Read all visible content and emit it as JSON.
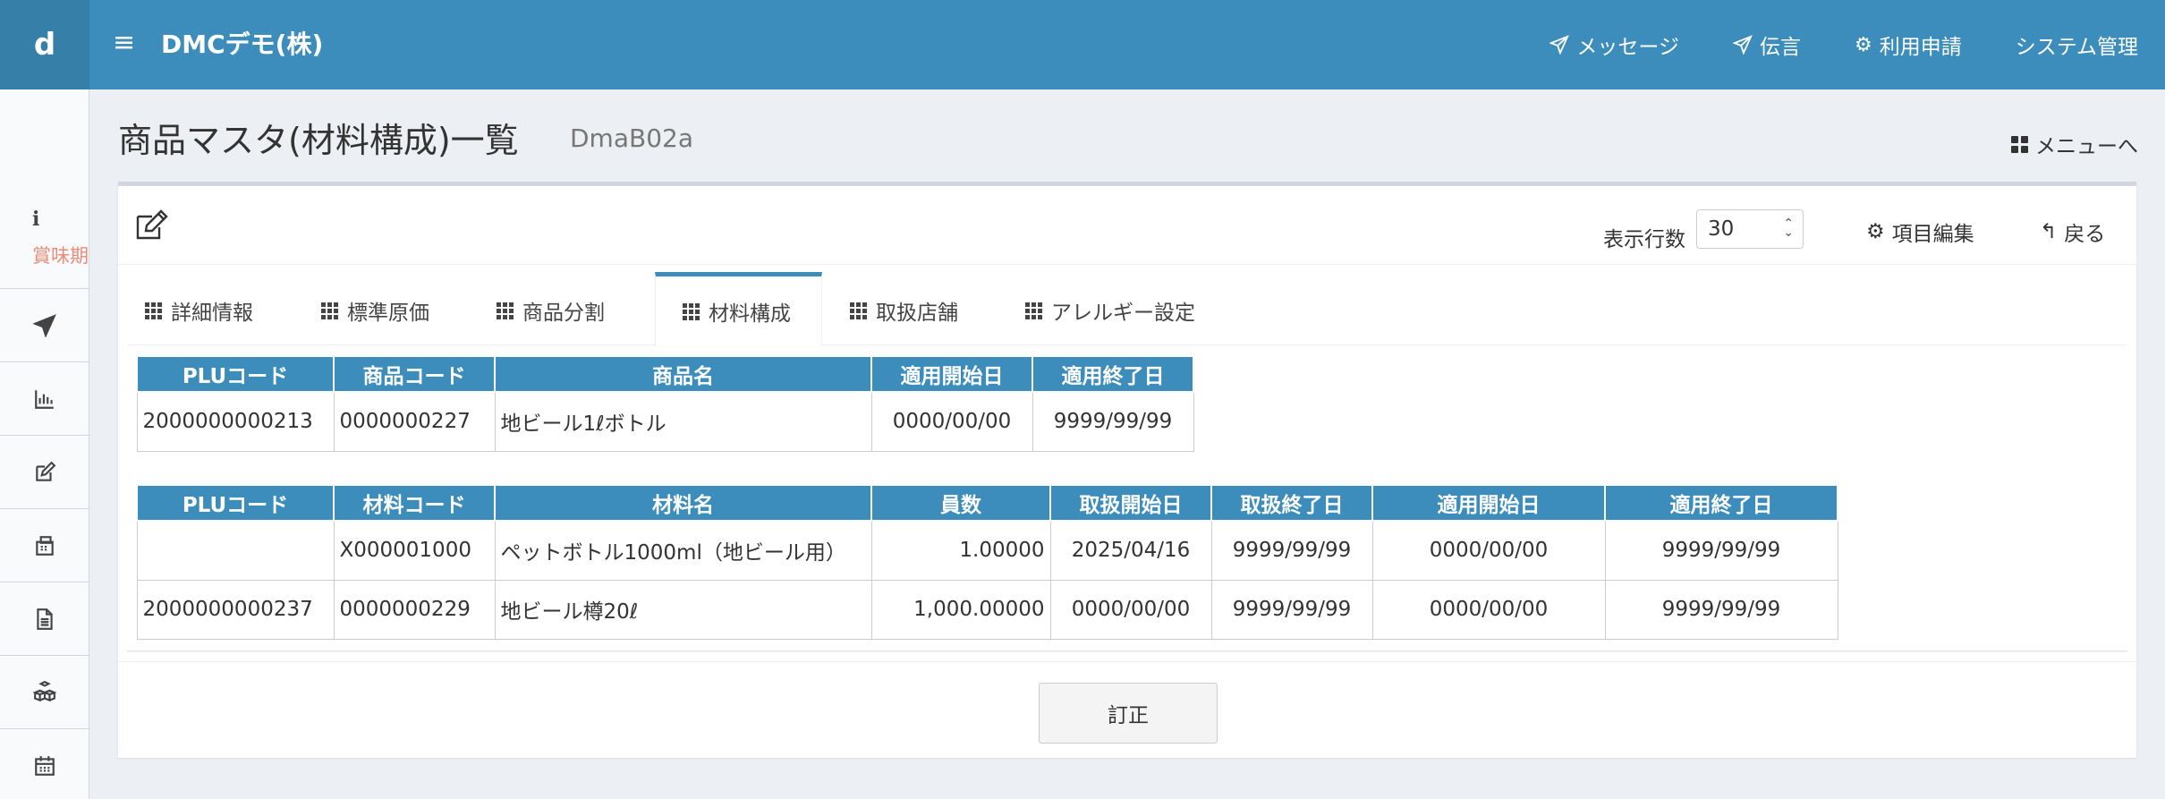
{
  "header": {
    "logo": "d",
    "hamburger": "≡",
    "brand": "DMCデモ(株)",
    "nav": [
      {
        "label": "メッセージ",
        "icon": "paper-plane-icon"
      },
      {
        "label": "伝言",
        "icon": "paper-plane-icon"
      },
      {
        "label": "利用申請",
        "icon": "gear-icon"
      },
      {
        "label": "システム管理",
        "icon": ""
      }
    ]
  },
  "sidebar": {
    "info_icon": "i",
    "info_text": "賞味期",
    "items": [
      "paper-plane-icon",
      "bar-chart-icon",
      "edit-icon",
      "fax-icon",
      "document-icon",
      "cubes-icon",
      "calendar-icon"
    ]
  },
  "page": {
    "title": "商品マスタ(材料構成)一覧",
    "code": "DmaB02a",
    "menu_link": "メニューへ"
  },
  "toolbar": {
    "rows_label": "表示行数",
    "rows_value": "30",
    "item_edit": "項目編集",
    "back": "戻る"
  },
  "tabs": [
    {
      "label": "詳細情報",
      "active": false
    },
    {
      "label": "標準原価",
      "active": false
    },
    {
      "label": "商品分割",
      "active": false
    },
    {
      "label": "材料構成",
      "active": true
    },
    {
      "label": "取扱店舗",
      "active": false
    },
    {
      "label": "アレルギー設定",
      "active": false
    }
  ],
  "product_table": {
    "headers": [
      "PLUコード",
      "商品コード",
      "商品名",
      "適用開始日",
      "適用終了日"
    ],
    "rows": [
      [
        "2000000000213",
        "0000000227",
        "地ビール1ℓボトル",
        "0000/00/00",
        "9999/99/99"
      ]
    ]
  },
  "material_table": {
    "headers": [
      "PLUコード",
      "材料コード",
      "材料名",
      "員数",
      "取扱開始日",
      "取扱終了日",
      "適用開始日",
      "適用終了日"
    ],
    "rows": [
      [
        "",
        "X000001000",
        "ペットボトル1000ml（地ビール用）",
        "1.00000",
        "2025/04/16",
        "9999/99/99",
        "0000/00/00",
        "9999/99/99"
      ],
      [
        "2000000000237",
        "0000000229",
        "地ビール樽20ℓ",
        "1,000.00000",
        "0000/00/00",
        "9999/99/99",
        "0000/00/00",
        "9999/99/99"
      ]
    ]
  },
  "actions": {
    "fix_button": "訂正"
  },
  "colors": {
    "primary": "#3c8dbc",
    "background": "#eceff3",
    "sidebar_text_accent": "#e98b78"
  }
}
